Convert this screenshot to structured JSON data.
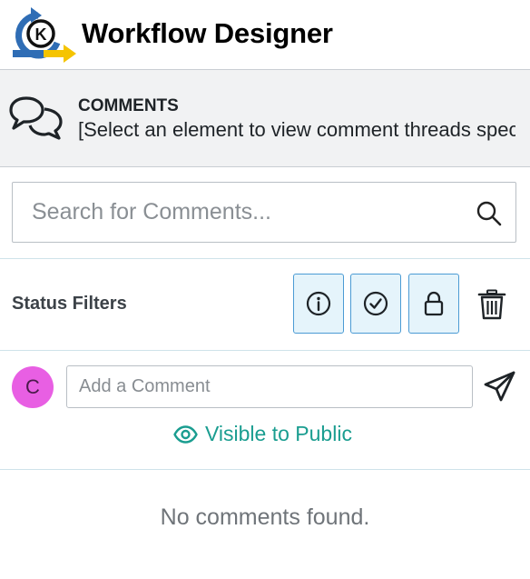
{
  "app": {
    "title": "Workflow Designer",
    "logo_letter": "K"
  },
  "comments_panel": {
    "heading": "COMMENTS",
    "description": "[Select an element to view comment threads specific to it]",
    "icon": "speech-bubbles-icon"
  },
  "search": {
    "placeholder": "Search for Comments...",
    "value": "",
    "icon": "search-icon"
  },
  "status_filters": {
    "label": "Status Filters",
    "filters": [
      {
        "icon": "info-icon"
      },
      {
        "icon": "check-circle-icon"
      },
      {
        "icon": "lock-icon"
      }
    ],
    "clear_icon": "trash-icon"
  },
  "new_comment": {
    "avatar_initial": "C",
    "placeholder": "Add a Comment",
    "value": "",
    "send_icon": "send-icon",
    "visibility_label": "Visible to Public",
    "visibility_icon": "eye-icon"
  },
  "empty_state": "No comments found.",
  "colors": {
    "accent_teal": "#1a9d90",
    "filter_border": "#4b9bd4",
    "filter_bg": "#e5f4fb",
    "avatar_bg": "#e85fe3",
    "logo_blue": "#2f6db5",
    "logo_yellow": "#f5c400"
  }
}
